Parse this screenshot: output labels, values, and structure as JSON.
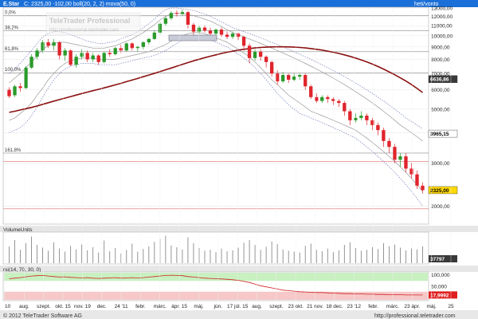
{
  "header": {
    "instrument": "E.Star",
    "quote_text": "C: 2325,00  -102,00  boll(20, 2, 2)  mova(50, 0)",
    "period": "heti/vonto"
  },
  "watermark": {
    "brand": "TeleTrader Professional",
    "url": "http://professional.teletrader.com"
  },
  "footer": {
    "copyright": "© 2012 TeleTrader Software AG",
    "url": "http://professional.teletrader.com"
  },
  "colors": {
    "up": "#2a9a2a",
    "down": "#e0242c",
    "ma": "#8b1010",
    "band_outer": "#6f7ab8",
    "band_inner": "#9a9a9a",
    "header_bg": "#1a6fd8",
    "rsi_upper_zone": "#c8f0c0",
    "rsi_lower_zone": "#f6c8c8"
  },
  "chart_data": [
    {
      "type": "candlestick",
      "panel": "price",
      "y_scale": "log",
      "ylim": [
        1700,
        13000
      ],
      "y_ticks": [
        "13000,00",
        "12000,00",
        "11000,00",
        "10000,00",
        "9000,00",
        "8000,00",
        "7000,00",
        "6000,00",
        "5000,00",
        "4000,00",
        "3000,00",
        "2000,00"
      ],
      "x_tick_labels": [
        "10",
        "aug.",
        "szept.",
        "okt. 15",
        "nov. 19",
        "dec.",
        "24 '11",
        "febr.",
        "márc.",
        "ápr. 15",
        "máj.",
        "jún.",
        "17 júl. 15",
        "aug.",
        "szept.",
        "23 okt.",
        "21 nov.",
        "18 dec.",
        "23 '12",
        "febr.",
        "márc.",
        "23 ápr.",
        "máj.",
        "25"
      ],
      "fib_levels": [
        {
          "label": "0,0%",
          "value": 12100
        },
        {
          "label": "38,2%",
          "value": 10500
        },
        {
          "label": "61,8%",
          "value": 8600
        },
        {
          "label": "100,0%",
          "value": 7050
        },
        {
          "label": "161,8%",
          "value": 3300
        }
      ],
      "value_tags": [
        {
          "label": "6636,86",
          "value": 6636.86
        },
        {
          "label": "3965,15",
          "value": 3965.15
        },
        {
          "label": "2325,00",
          "value": 2325
        }
      ],
      "candles": [
        [
          6000,
          5650,
          6150,
          5550
        ],
        [
          5700,
          6200,
          6300,
          5600
        ],
        [
          6200,
          6100,
          6400,
          5900
        ],
        [
          6100,
          7400,
          7500,
          6050
        ],
        [
          7400,
          8200,
          8400,
          7300
        ],
        [
          8200,
          8700,
          8900,
          8000
        ],
        [
          8700,
          9400,
          9600,
          8500
        ],
        [
          9400,
          9100,
          9700,
          8900
        ],
        [
          9100,
          9400,
          9700,
          8700
        ],
        [
          9400,
          8300,
          9500,
          8000
        ],
        [
          8300,
          8700,
          8900,
          7900
        ],
        [
          8700,
          7600,
          8800,
          7500
        ],
        [
          7600,
          8200,
          8400,
          7400
        ],
        [
          8200,
          8500,
          8800,
          8000
        ],
        [
          8500,
          8000,
          8700,
          7800
        ],
        [
          8000,
          8300,
          8500,
          7800
        ],
        [
          8300,
          7800,
          8400,
          7600
        ],
        [
          7800,
          8500,
          8600,
          7700
        ],
        [
          8500,
          8400,
          8800,
          8200
        ],
        [
          8400,
          8900,
          9000,
          8300
        ],
        [
          8900,
          8700,
          9200,
          8500
        ],
        [
          8700,
          9300,
          9400,
          8600
        ],
        [
          9300,
          8900,
          9400,
          8700
        ],
        [
          8900,
          9000,
          9100,
          8600
        ],
        [
          9000,
          9400,
          9500,
          8800
        ],
        [
          9400,
          9700,
          9800,
          9200
        ],
        [
          9700,
          10300,
          10500,
          9600
        ],
        [
          10300,
          11200,
          11400,
          10100
        ],
        [
          11200,
          11800,
          12000,
          11000
        ],
        [
          11800,
          12400,
          12600,
          11600
        ],
        [
          12400,
          12300,
          12700,
          12000
        ],
        [
          12300,
          12500,
          12800,
          12100
        ],
        [
          12500,
          11100,
          12600,
          10700
        ],
        [
          11100,
          10400,
          11300,
          10000
        ],
        [
          10400,
          10800,
          11000,
          10200
        ],
        [
          10800,
          10500,
          11000,
          10300
        ],
        [
          10500,
          10200,
          10800,
          10000
        ],
        [
          10200,
          10600,
          10700,
          10000
        ],
        [
          10600,
          10100,
          10800,
          9900
        ],
        [
          10100,
          9900,
          10400,
          9700
        ],
        [
          9900,
          10200,
          10400,
          9700
        ],
        [
          10200,
          9900,
          10300,
          9600
        ],
        [
          9900,
          9100,
          10000,
          8700
        ],
        [
          9100,
          8100,
          9300,
          7700
        ],
        [
          8100,
          8600,
          8800,
          7900
        ],
        [
          8600,
          8200,
          8800,
          7900
        ],
        [
          8200,
          7800,
          8300,
          7400
        ],
        [
          7800,
          7000,
          7900,
          6800
        ],
        [
          7000,
          6500,
          7200,
          6300
        ],
        [
          6500,
          6900,
          7100,
          6400
        ],
        [
          6900,
          6600,
          7000,
          6400
        ],
        [
          6600,
          6800,
          7000,
          6500
        ],
        [
          6800,
          6900,
          7000,
          6600
        ],
        [
          6900,
          6200,
          7000,
          6000
        ],
        [
          6200,
          5600,
          6300,
          5500
        ],
        [
          5600,
          5400,
          5800,
          5300
        ],
        [
          5400,
          5600,
          5700,
          5300
        ],
        [
          5600,
          5500,
          5700,
          5300
        ],
        [
          5500,
          5400,
          5600,
          5200
        ],
        [
          5400,
          5300,
          5500,
          5100
        ],
        [
          5300,
          4900,
          5400,
          4700
        ],
        [
          4900,
          4500,
          5000,
          4300
        ],
        [
          4500,
          4600,
          4800,
          4400
        ],
        [
          4600,
          4700,
          4900,
          4500
        ],
        [
          4700,
          4500,
          4800,
          4300
        ],
        [
          4500,
          4300,
          4600,
          4100
        ],
        [
          4300,
          4100,
          4400,
          3900
        ],
        [
          4100,
          3700,
          4200,
          3500
        ],
        [
          3700,
          3500,
          3800,
          3300
        ],
        [
          3500,
          3100,
          3600,
          3000
        ],
        [
          3100,
          3200,
          3300,
          2900
        ],
        [
          3200,
          2850,
          3300,
          2750
        ],
        [
          2850,
          2700,
          3000,
          2600
        ],
        [
          2700,
          2425,
          2800,
          2350
        ],
        [
          2425,
          2325,
          2500,
          2250
        ]
      ],
      "moving_average": [
        4850,
        4900,
        4960,
        5020,
        5080,
        5150,
        5230,
        5310,
        5390,
        5470,
        5550,
        5630,
        5710,
        5790,
        5870,
        5950,
        6030,
        6110,
        6200,
        6290,
        6380,
        6480,
        6580,
        6680,
        6790,
        6900,
        7010,
        7130,
        7250,
        7370,
        7500,
        7630,
        7760,
        7890,
        8010,
        8130,
        8240,
        8350,
        8460,
        8560,
        8650,
        8730,
        8800,
        8860,
        8910,
        8950,
        8980,
        9000,
        9010,
        9010,
        9000,
        8980,
        8950,
        8910,
        8860,
        8800,
        8730,
        8650,
        8560,
        8460,
        8350,
        8230,
        8100,
        7960,
        7810,
        7650,
        7480,
        7300,
        7110,
        6920,
        6720,
        6520,
        6300,
        6080,
        5850
      ],
      "band_outer_upper": [
        7000,
        7300,
        7700,
        8200,
        8700,
        9300,
        9900,
        10200,
        10400,
        10400,
        10300,
        10100,
        9900,
        9700,
        9500,
        9400,
        9300,
        9300,
        9400,
        9500,
        9700,
        9900,
        10100,
        10400,
        10800,
        11200,
        11700,
        12300,
        12800,
        13000,
        13000,
        12900,
        12800,
        12700,
        12500,
        12300,
        12000,
        11700,
        11400,
        11100,
        10800,
        10600,
        10400,
        10200,
        10000,
        9800,
        9600,
        9400,
        9200,
        9000,
        8800,
        8600,
        8400,
        8200,
        8000,
        7800,
        7600,
        7400,
        7200,
        7000,
        6800,
        6600,
        6400,
        6200,
        6000,
        5800,
        5600,
        5400,
        5200,
        5000,
        4800,
        4600,
        4450,
        4300,
        4150
      ],
      "band_outer_lower": [
        4000,
        4100,
        4200,
        4400,
        4700,
        5100,
        5600,
        6100,
        6600,
        7000,
        7300,
        7500,
        7600,
        7700,
        7700,
        7700,
        7600,
        7600,
        7600,
        7600,
        7700,
        7800,
        7900,
        8000,
        8100,
        8200,
        8300,
        8500,
        8700,
        9000,
        9300,
        9600,
        9800,
        9900,
        9900,
        9800,
        9600,
        9400,
        9200,
        9000,
        8700,
        8400,
        8100,
        7800,
        7400,
        7000,
        6600,
        6200,
        5800,
        5500,
        5200,
        5000,
        4800,
        4700,
        4600,
        4500,
        4400,
        4300,
        4200,
        4100,
        4000,
        3900,
        3800,
        3650,
        3500,
        3350,
        3200,
        3050,
        2900,
        2750,
        2600,
        2450,
        2300,
        2150,
        2000
      ],
      "band_inner_upper": [
        6400,
        6700,
        7000,
        7400,
        7800,
        8300,
        8800,
        9100,
        9300,
        9400,
        9400,
        9300,
        9200,
        9100,
        9000,
        8900,
        8900,
        8900,
        9000,
        9100,
        9300,
        9500,
        9700,
        10000,
        10300,
        10700,
        11100,
        11600,
        12000,
        12300,
        12400,
        12300,
        12200,
        12100,
        11900,
        11700,
        11500,
        11200,
        10900,
        10600,
        10300,
        10100,
        9900,
        9700,
        9500,
        9300,
        9100,
        8900,
        8700,
        8500,
        8300,
        8100,
        7900,
        7700,
        7500,
        7300,
        7100,
        6900,
        6700,
        6500,
        6300,
        6100,
        5900,
        5700,
        5500,
        5300,
        5100,
        4900,
        4700,
        4500,
        4300,
        4150,
        4000,
        3850,
        3700
      ],
      "band_inner_lower": [
        4500,
        4600,
        4800,
        5000,
        5300,
        5700,
        6100,
        6600,
        7000,
        7400,
        7700,
        7900,
        8000,
        8100,
        8100,
        8100,
        8000,
        8000,
        8000,
        8000,
        8100,
        8200,
        8300,
        8400,
        8500,
        8600,
        8800,
        9000,
        9200,
        9500,
        9800,
        10000,
        10200,
        10300,
        10300,
        10200,
        10000,
        9800,
        9600,
        9400,
        9100,
        8800,
        8500,
        8200,
        7800,
        7400,
        7000,
        6600,
        6300,
        6000,
        5700,
        5500,
        5300,
        5100,
        4900,
        4800,
        4700,
        4600,
        4500,
        4400,
        4300,
        4200,
        4100,
        3950,
        3800,
        3650,
        3500,
        3350,
        3200,
        3050,
        2900,
        2750,
        2600,
        2450,
        2300
      ]
    },
    {
      "type": "bar",
      "panel": "volume",
      "label": "VolumeUnits",
      "value_tag": "37797",
      "values": [
        38000,
        52000,
        30000,
        45000,
        60000,
        41000,
        35000,
        28000,
        47000,
        33000,
        26000,
        39000,
        31000,
        42000,
        29000,
        36000,
        24000,
        51000,
        27000,
        34000,
        22000,
        30000,
        44000,
        26000,
        32000,
        38000,
        48000,
        55000,
        62000,
        40000,
        36000,
        31000,
        58000,
        45000,
        34000,
        28000,
        30000,
        25000,
        33000,
        27000,
        29000,
        35000,
        46000,
        52000,
        41000,
        30000,
        37000,
        49000,
        43000,
        31000,
        28000,
        26000,
        24000,
        39000,
        44000,
        30000,
        27000,
        33000,
        25000,
        29000,
        41000,
        47000,
        34000,
        28000,
        30000,
        36000,
        32000,
        45000,
        38000,
        42000,
        35000,
        29000,
        33000,
        31000,
        37797
      ]
    },
    {
      "type": "line",
      "panel": "rsi",
      "label": "rsi(14, 70, 30, 0)",
      "y_ticks": [
        "100,000",
        "50,000"
      ],
      "value_tag": "17,9992",
      "ylim": [
        0,
        100
      ],
      "zones": [
        70,
        30
      ],
      "values": [
        78,
        80,
        82,
        85,
        88,
        89,
        90,
        88,
        86,
        84,
        85,
        83,
        82,
        81,
        82,
        80,
        79,
        80,
        81,
        82,
        80,
        81,
        82,
        81,
        82,
        84,
        86,
        88,
        90,
        91,
        90,
        89,
        86,
        84,
        82,
        80,
        79,
        78,
        77,
        76,
        74,
        72,
        68,
        64,
        58,
        52,
        48,
        44,
        40,
        36,
        34,
        32,
        30,
        29,
        28,
        27,
        27,
        26,
        25,
        24,
        23,
        23,
        22,
        22,
        21,
        21,
        20,
        20,
        19,
        19,
        19,
        18,
        18,
        18,
        18
      ]
    }
  ]
}
